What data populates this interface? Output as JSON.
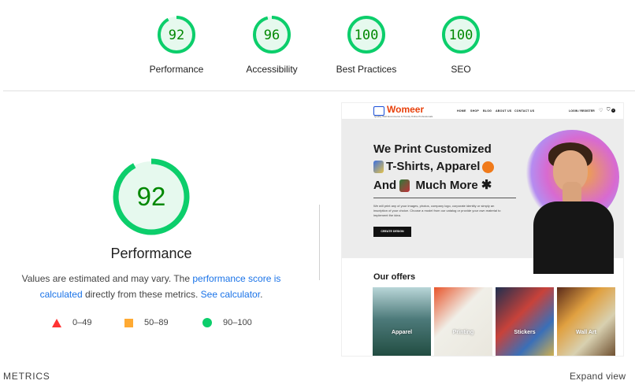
{
  "gauges": [
    {
      "score": "92",
      "label": "Performance",
      "value": 0.92
    },
    {
      "score": "96",
      "label": "Accessibility",
      "value": 0.96
    },
    {
      "score": "100",
      "label": "Best Practices",
      "value": 1.0
    },
    {
      "score": "100",
      "label": "SEO",
      "value": 1.0
    }
  ],
  "main": {
    "score": "92",
    "value": 0.92,
    "title": "Performance",
    "desc_1": "Values are estimated and may vary. The ",
    "link_score": "performance score is calculated",
    "desc_2": " directly from these metrics. ",
    "link_calc": "See calculator",
    "desc_3": "."
  },
  "legend": [
    {
      "label": "0–49",
      "color": "#ff3333"
    },
    {
      "label": "50–89",
      "color": "#ffaa33"
    },
    {
      "label": "90–100",
      "color": "#0cce6b"
    }
  ],
  "colors": {
    "pass": "#0cce6b",
    "pass_text": "#008800",
    "pass_bg": "#e6f9ee"
  },
  "preview": {
    "brand": "Womeer",
    "tagline": "Quality Web Ecommerce & Trendy Online Professionals",
    "nav": [
      "HOME",
      "SHOP",
      "BLOG",
      "ABOUT US",
      "CONTACT US"
    ],
    "login": "LOGIN / REGISTER",
    "cart_count": "0",
    "hero_line1": "We Print Customized",
    "hero_line2": "T-Shirts, Apparel",
    "hero_line3a": "And",
    "hero_line3b": "Much More",
    "hero_copy": "We will print any of your images, photos, company logo, corporate identity or simply an inscription of your choice. Choose a model from our catalog or provide your own material to implement the idea.",
    "hero_button": "CREATE DESIGN",
    "offers_title": "Our offers",
    "cards": [
      "Apparel",
      "Printing",
      "Stickers",
      "Wall Art"
    ]
  },
  "footer": {
    "metrics": "METRICS",
    "expand": "Expand view"
  }
}
